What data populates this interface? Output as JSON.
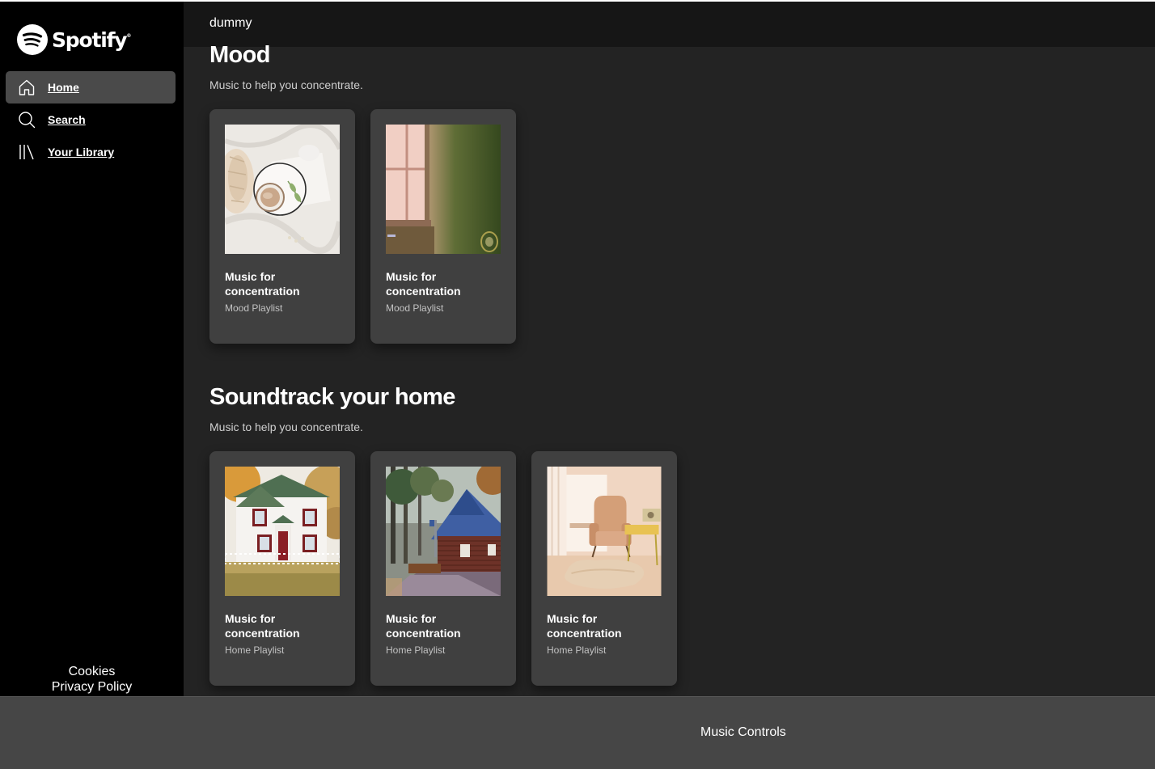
{
  "app": {
    "name": "Spotify",
    "trademark": "®"
  },
  "sidebar": {
    "items": [
      {
        "label": "Home",
        "icon": "home-icon",
        "active": true
      },
      {
        "label": "Search",
        "icon": "search-icon",
        "active": false
      },
      {
        "label": "Your Library",
        "icon": "library-icon",
        "active": false
      }
    ],
    "footer": {
      "cookies": "Cookies",
      "privacy": "Privacy Policy"
    }
  },
  "header": {
    "username": "dummy"
  },
  "sections": [
    {
      "title": "Mood",
      "subtitle": "Music to help you concentrate.",
      "cards": [
        {
          "title": "Music for concentration",
          "subtitle": "Mood Playlist",
          "image": "coffee-on-bed-image"
        },
        {
          "title": "Music for concentration",
          "subtitle": "Mood Playlist",
          "image": "window-light-image"
        }
      ]
    },
    {
      "title": "Soundtrack your home",
      "subtitle": "Music to help you concentrate.",
      "cards": [
        {
          "title": "Music for concentration",
          "subtitle": "Home Playlist",
          "image": "white-house-image"
        },
        {
          "title": "Music for concentration",
          "subtitle": "Home Playlist",
          "image": "log-cabin-image"
        },
        {
          "title": "Music for concentration",
          "subtitle": "Home Playlist",
          "image": "armchair-room-image"
        }
      ]
    }
  ],
  "player": {
    "label": "Music Controls"
  },
  "colors": {
    "sidebar_bg": "#000000",
    "main_bg": "#232323",
    "header_bg": "#161616",
    "card_bg": "#404040",
    "active_nav_bg": "#4a4a4a",
    "player_bg": "#464646"
  }
}
